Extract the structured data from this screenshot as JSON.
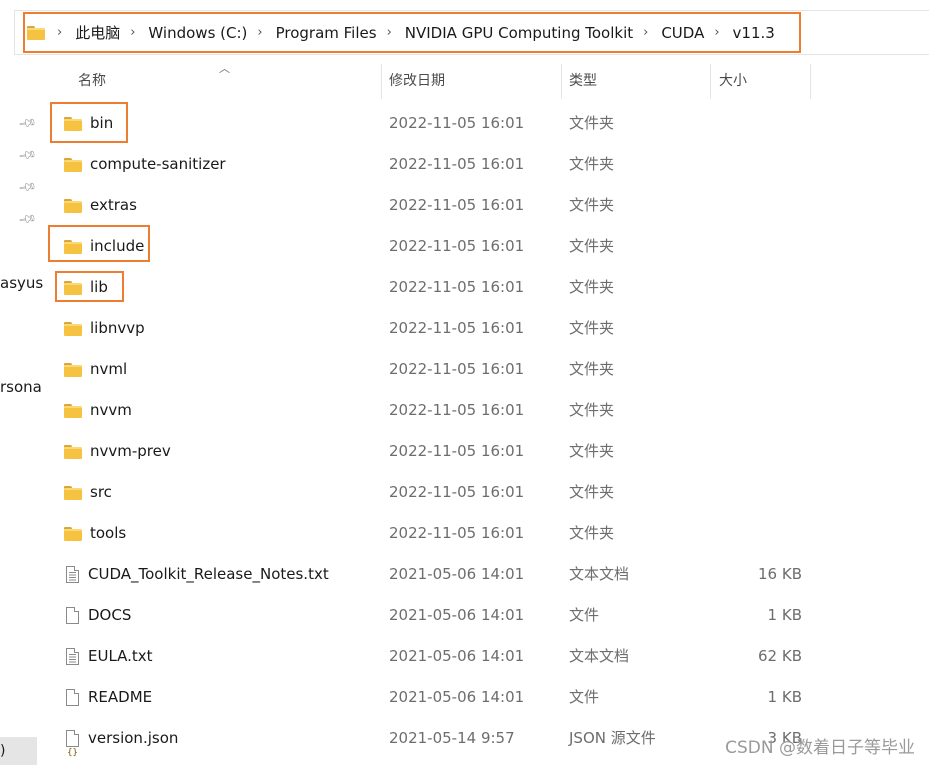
{
  "breadcrumb": {
    "items": [
      "此电脑",
      "Windows (C:)",
      "Program Files",
      "NVIDIA GPU Computing Toolkit",
      "CUDA",
      "v11.3"
    ]
  },
  "columns": {
    "name": "名称",
    "date": "修改日期",
    "type": "类型",
    "size": "大小"
  },
  "left_nav": {
    "fragments": [
      "asyus",
      "rsona",
      ")"
    ]
  },
  "files": [
    {
      "name": "bin",
      "date": "2022-11-05 16:01",
      "type": "文件夹",
      "size": "",
      "icon": "folder-icon"
    },
    {
      "name": "compute-sanitizer",
      "date": "2022-11-05 16:01",
      "type": "文件夹",
      "size": "",
      "icon": "folder-icon"
    },
    {
      "name": "extras",
      "date": "2022-11-05 16:01",
      "type": "文件夹",
      "size": "",
      "icon": "folder-icon"
    },
    {
      "name": "include",
      "date": "2022-11-05 16:01",
      "type": "文件夹",
      "size": "",
      "icon": "folder-icon"
    },
    {
      "name": "lib",
      "date": "2022-11-05 16:01",
      "type": "文件夹",
      "size": "",
      "icon": "folder-icon"
    },
    {
      "name": "libnvvp",
      "date": "2022-11-05 16:01",
      "type": "文件夹",
      "size": "",
      "icon": "folder-icon"
    },
    {
      "name": "nvml",
      "date": "2022-11-05 16:01",
      "type": "文件夹",
      "size": "",
      "icon": "folder-icon"
    },
    {
      "name": "nvvm",
      "date": "2022-11-05 16:01",
      "type": "文件夹",
      "size": "",
      "icon": "folder-icon"
    },
    {
      "name": "nvvm-prev",
      "date": "2022-11-05 16:01",
      "type": "文件夹",
      "size": "",
      "icon": "folder-icon"
    },
    {
      "name": "src",
      "date": "2022-11-05 16:01",
      "type": "文件夹",
      "size": "",
      "icon": "folder-icon"
    },
    {
      "name": "tools",
      "date": "2022-11-05 16:01",
      "type": "文件夹",
      "size": "",
      "icon": "folder-icon"
    },
    {
      "name": "CUDA_Toolkit_Release_Notes.txt",
      "date": "2021-05-06 14:01",
      "type": "文本文档",
      "size": "16 KB",
      "icon": "text-file-icon"
    },
    {
      "name": "DOCS",
      "date": "2021-05-06 14:01",
      "type": "文件",
      "size": "1 KB",
      "icon": "file-icon"
    },
    {
      "name": "EULA.txt",
      "date": "2021-05-06 14:01",
      "type": "文本文档",
      "size": "62 KB",
      "icon": "text-file-icon"
    },
    {
      "name": "README",
      "date": "2021-05-06 14:01",
      "type": "文件",
      "size": "1 KB",
      "icon": "file-icon"
    },
    {
      "name": "version.json",
      "date": "2021-05-14 9:57",
      "type": "JSON 源文件",
      "size": "3 KB",
      "icon": "json-file-icon"
    }
  ],
  "watermark": "CSDN @数着日子等毕业",
  "colors": {
    "highlight": "#ed7d31",
    "folder": "#f5c242"
  }
}
